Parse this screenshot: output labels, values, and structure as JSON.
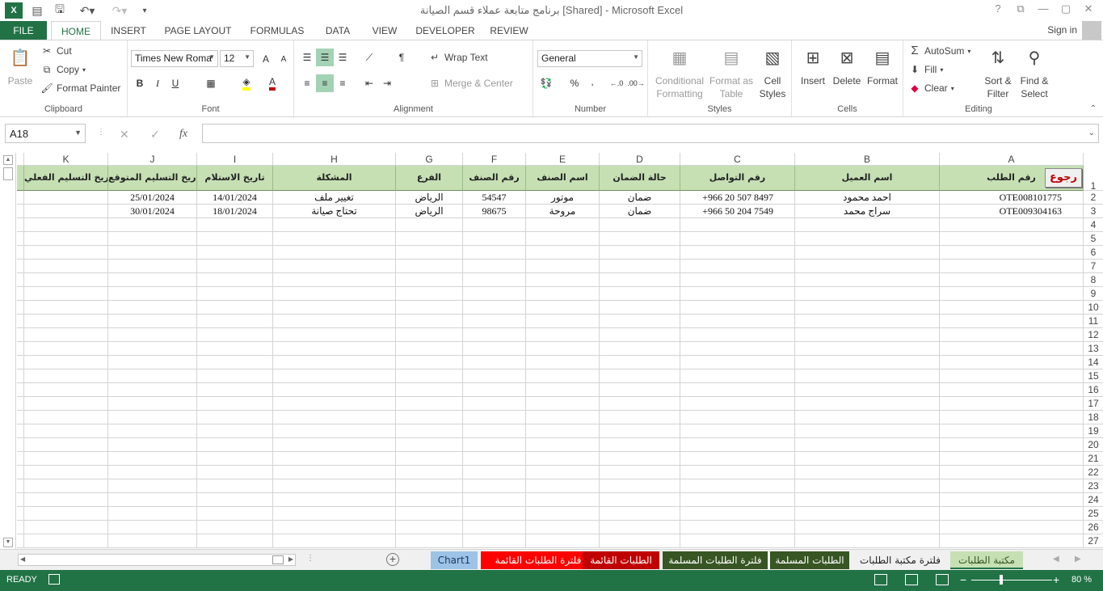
{
  "window": {
    "title": "برنامج متابعة عملاء قسم الصيانة [Shared] - Microsoft Excel",
    "help": "?",
    "restore": "⧉",
    "minimize": "—",
    "maximize": "▢",
    "close": "✕"
  },
  "ribbon_tabs": [
    "FILE",
    "HOME",
    "INSERT",
    "PAGE LAYOUT",
    "FORMULAS",
    "DATA",
    "VIEW",
    "DEVELOPER",
    "REVIEW"
  ],
  "active_tab": "HOME",
  "sign_in": "Sign in",
  "clipboard": {
    "paste": "Paste",
    "cut": "Cut",
    "copy": "Copy",
    "format_painter": "Format Painter",
    "label": "Clipboard"
  },
  "font": {
    "name": "Times New Roma",
    "size": "12",
    "bold": "B",
    "italic": "I",
    "underline": "U",
    "grow": "A",
    "shrink": "A",
    "label": "Font",
    "fill_color": "#ffff00",
    "font_color": "#c00000"
  },
  "alignment": {
    "wrap_text": "Wrap Text",
    "merge_center": "Merge & Center",
    "label": "Alignment"
  },
  "number": {
    "format": "General",
    "percent": "%",
    "comma": ",",
    "label": "Number"
  },
  "styles": {
    "conditional": [
      "Conditional",
      "Formatting"
    ],
    "format_table": [
      "Format as",
      "Table"
    ],
    "cell_styles": [
      "Cell",
      "Styles"
    ],
    "label": "Styles"
  },
  "cells": {
    "insert": "Insert",
    "delete": "Delete",
    "format": "Format",
    "label": "Cells"
  },
  "editing": {
    "autosum": "AutoSum",
    "fill": "Fill",
    "clear": "Clear",
    "sort_filter": [
      "Sort &",
      "Filter"
    ],
    "find_select": [
      "Find &",
      "Select"
    ],
    "label": "Editing"
  },
  "formula_bar": {
    "name_box": "A18",
    "cancel": "✕",
    "enter": "✓",
    "fx": "fx",
    "value": ""
  },
  "columns": [
    "A",
    "B",
    "C",
    "D",
    "E",
    "F",
    "G",
    "H",
    "I",
    "J",
    "K"
  ],
  "header_row": {
    "A": "رقم الطلب",
    "B": "اسم العميل",
    "C": "رقم التواصل",
    "D": "حالة الضمان",
    "E": "اسم الصنف",
    "F": "رقم الصنف",
    "G": "الفرع",
    "H": "المشكلة",
    "I": "تاريخ الاستلام",
    "J": "تاريخ التسليم المتوقع",
    "K": "تاريخ التسليم الفعلي"
  },
  "back_button": "رجوع",
  "rows": [
    {
      "A": "OTE008101775",
      "B": "احمد محمود",
      "C": "+966 20 507 8497",
      "D": "ضمان",
      "E": "موتور",
      "F": "54547",
      "G": "الرياض",
      "H": "تغيير ملف",
      "I": "14/01/2024",
      "J": "25/01/2024",
      "K": ""
    },
    {
      "A": "OTE009304163",
      "B": "سراج محمد",
      "C": "+966 50 204 7549",
      "D": "ضمان",
      "E": "مروحة",
      "F": "98675",
      "G": "الرياض",
      "H": "تحتاج صيانة",
      "I": "18/01/2024",
      "J": "30/01/2024",
      "K": ""
    }
  ],
  "row_numbers": [
    "1",
    "2",
    "3",
    "4",
    "5",
    "6",
    "7",
    "8",
    "9",
    "10",
    "11",
    "12",
    "13",
    "14",
    "15",
    "16",
    "17",
    "18",
    "19",
    "20",
    "21",
    "22",
    "23",
    "24",
    "25",
    "26",
    "27"
  ],
  "sheet_tabs": [
    {
      "label": "Chart1",
      "bg": "#9dc3e6",
      "fg": "#1f3864"
    },
    {
      "label": "فلترة الطلبات القائمة",
      "bg": "#ff0000",
      "fg": "#ffffff"
    },
    {
      "label": "الطلبات القائمة",
      "bg": "#c00000",
      "fg": "#ffffff"
    },
    {
      "label": "فلترة الطلبات المسلمة",
      "bg": "#375623",
      "fg": "#ffffff"
    },
    {
      "label": "الطلبات المسلمة",
      "bg": "#375623",
      "fg": "#ffffff"
    },
    {
      "label": "فلترة مكتبة الطلبات",
      "bg": "#f0f0f0",
      "fg": "#222222"
    },
    {
      "label": "مكتبة الطلبات",
      "bg": "#c6e0b4",
      "fg": "#375623"
    }
  ],
  "status": {
    "ready": "READY",
    "zoom": "80 %",
    "zoom_minus": "−",
    "zoom_plus": "+"
  }
}
